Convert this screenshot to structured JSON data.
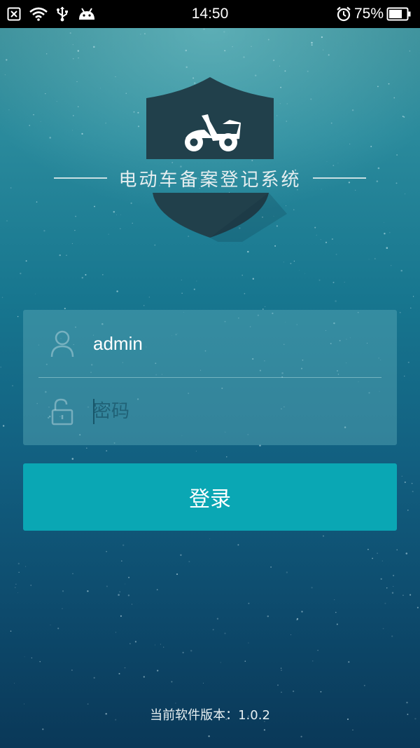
{
  "status_bar": {
    "time": "14:50",
    "battery_percent": "75%",
    "battery_level": 0.75,
    "icons": [
      "close-box-icon",
      "wifi-icon",
      "usb-icon",
      "android-icon",
      "alarm-icon",
      "battery-icon"
    ]
  },
  "app": {
    "title": "电动车备案登记系统",
    "logo_icon": "scooter-shield-icon"
  },
  "login_form": {
    "username_value": "admin",
    "password_placeholder": "密码",
    "username_icon": "user-icon",
    "password_icon": "lock-icon",
    "login_label": "登录"
  },
  "footer": {
    "version_text": "当前软件版本：1.0.2"
  },
  "colors": {
    "button": "#0aa7b4",
    "shield": "#21404b"
  }
}
